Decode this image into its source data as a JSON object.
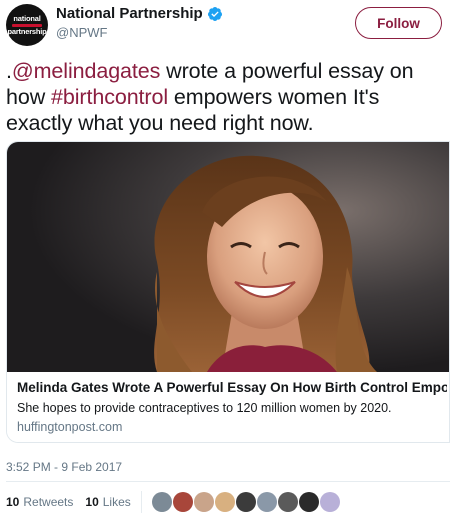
{
  "author": {
    "display_name": "National Partnership",
    "handle": "@NPWF",
    "avatar_text_line1": "national",
    "avatar_text_line2": "partnership",
    "verified": true
  },
  "follow_label": "Follow",
  "tweet": {
    "prefix": ".",
    "mention": "@melindagates",
    "text1": " wrote a powerful essay on how ",
    "hashtag": "#birthcontrol",
    "text2": " empowers women It's exactly what you need right now."
  },
  "card": {
    "title": "Melinda Gates Wrote A Powerful Essay On How Birth Control Empowers Wo...",
    "description": "She hopes to provide contraceptives to 120 million women by 2020.",
    "domain": "huffingtonpost.com"
  },
  "timestamp": "3:52 PM - 9 Feb 2017",
  "stats": {
    "retweets_count": "10",
    "retweets_label": "Retweets",
    "likes_count": "10",
    "likes_label": "Likes"
  },
  "colors": {
    "accent": "#8b1e40",
    "verified": "#1da1f2",
    "muted": "#657786"
  },
  "icons": [
    "verified-badge-icon"
  ]
}
